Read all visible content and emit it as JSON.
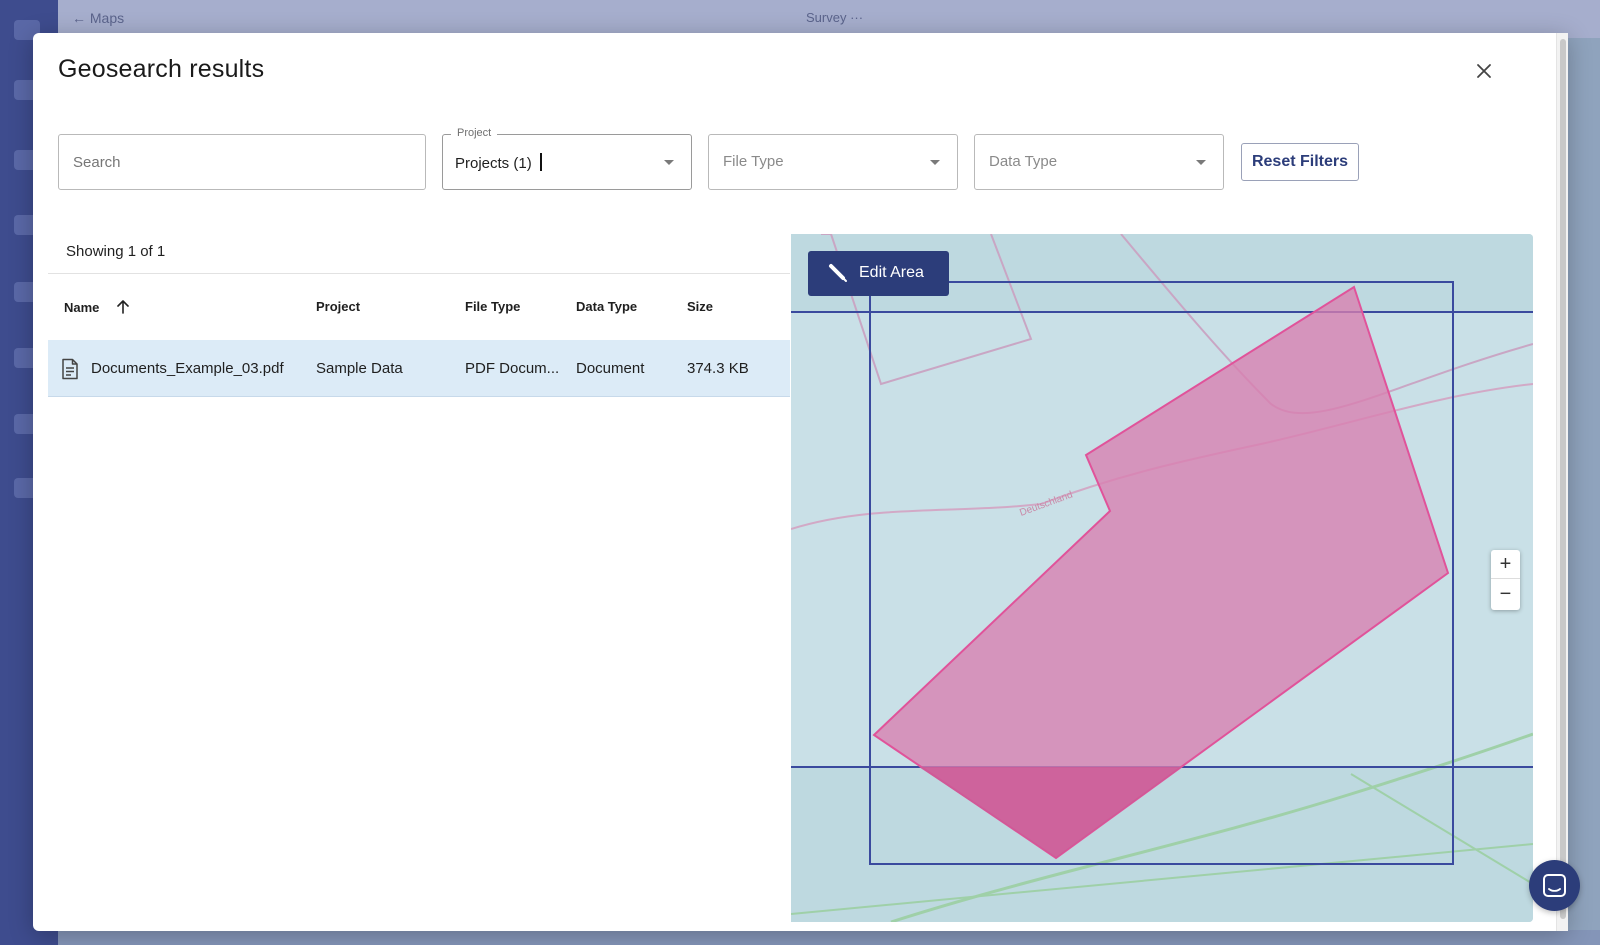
{
  "background": {
    "back_label": "← Maps",
    "title": "Survey ···"
  },
  "modal": {
    "title": "Geosearch results",
    "close_icon": "close-icon"
  },
  "filters": {
    "search_placeholder": "Search",
    "project": {
      "label": "Project",
      "value": "Projects (1)"
    },
    "file_type_placeholder": "File Type",
    "data_type_placeholder": "Data Type",
    "reset_label": "Reset Filters"
  },
  "results": {
    "showing": "Showing 1 of 1",
    "columns": {
      "name": "Name",
      "project": "Project",
      "file_type": "File Type",
      "data_type": "Data Type",
      "size": "Size"
    },
    "sort": {
      "column": "name",
      "direction": "ascending",
      "icon": "arrow-up-icon"
    },
    "rows": [
      {
        "icon": "document-icon",
        "name": "Documents_Example_03.pdf",
        "project": "Sample Data",
        "file_type": "PDF Docum...",
        "data_type": "Document",
        "size": "374.3 KB"
      }
    ]
  },
  "map": {
    "edit_area_label": "Edit Area",
    "edit_icon": "pencil-icon",
    "place_label": "Deutschland",
    "zoom_in_label": "+",
    "zoom_out_label": "−",
    "colors": {
      "water": "#bed9e0",
      "search_area_fill": "#d97fb0",
      "search_area_stroke": "#e0539a",
      "bounds_stroke": "#3a4a9e"
    }
  },
  "chat": {
    "icon": "chat-icon"
  },
  "theme": {
    "primary": "#2c3d7a",
    "selected_row": "#dcebf7"
  }
}
